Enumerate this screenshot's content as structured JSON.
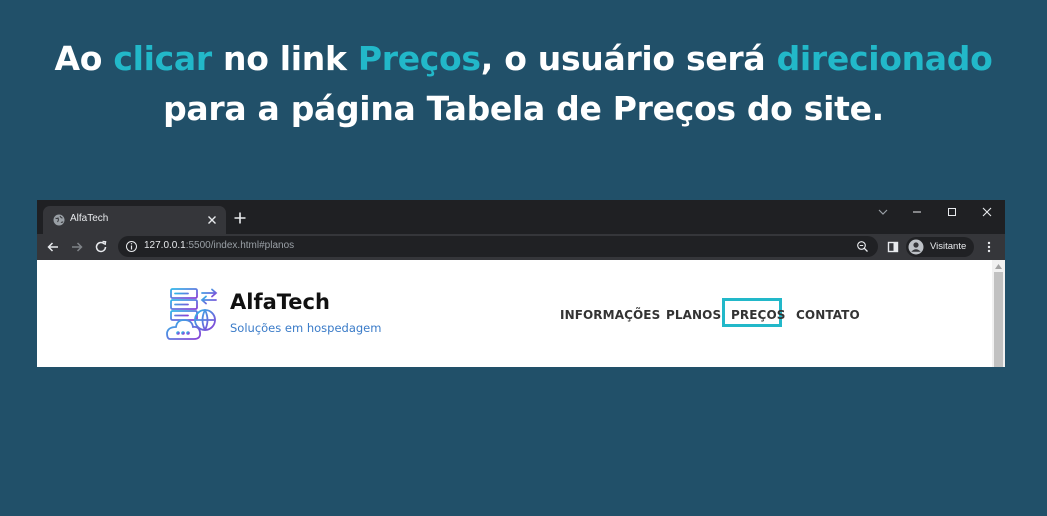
{
  "headline": {
    "line1": [
      {
        "text": "Ao ",
        "highlight": false
      },
      {
        "text": "clicar",
        "highlight": true
      },
      {
        "text": " no link ",
        "highlight": false
      },
      {
        "text": "Preços",
        "highlight": true
      },
      {
        "text": ", o usuário será ",
        "highlight": false
      },
      {
        "text": "direcionado",
        "highlight": true
      }
    ],
    "line2": "para a página Tabela de Preços do site."
  },
  "colors": {
    "background": "#215069",
    "highlight": "#22b8c9",
    "tagline": "#3a7bc8"
  },
  "browser": {
    "tab_title": "AlfaTech",
    "url_host": "127.0.0.1",
    "url_rest": ":5500/index.html#planos",
    "profile_label": "Visitante",
    "icons": [
      "globe-icon",
      "close-icon",
      "plus-icon",
      "chevron-down-icon",
      "minimize-icon",
      "maximize-icon",
      "close-window-icon",
      "back-arrow-icon",
      "forward-arrow-icon",
      "reload-icon",
      "info-icon",
      "zoom-icon",
      "side-panel-icon",
      "profile-avatar-icon",
      "kebab-menu-icon"
    ]
  },
  "site": {
    "brand": "AlfaTech",
    "tagline": "Soluções em hospedagem",
    "nav": [
      {
        "label": "INFORMAÇÕES"
      },
      {
        "label": "PLANOS"
      },
      {
        "label": "PREÇOS",
        "highlighted": true
      },
      {
        "label": "CONTATO"
      }
    ]
  }
}
